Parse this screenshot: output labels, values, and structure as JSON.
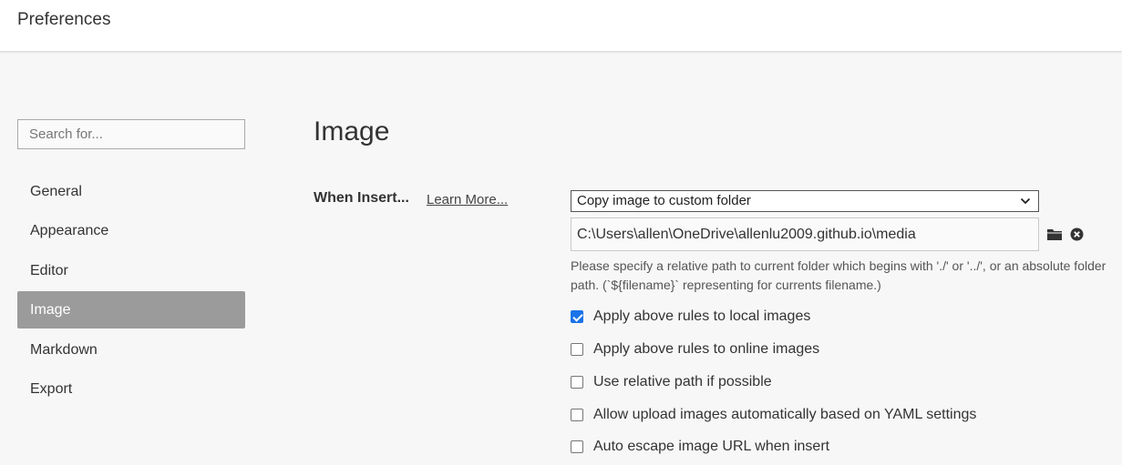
{
  "window": {
    "title": "Preferences"
  },
  "search": {
    "placeholder": "Search for..."
  },
  "sidebar": {
    "items": [
      {
        "label": "General",
        "active": false
      },
      {
        "label": "Appearance",
        "active": false
      },
      {
        "label": "Editor",
        "active": false
      },
      {
        "label": "Image",
        "active": true
      },
      {
        "label": "Markdown",
        "active": false
      },
      {
        "label": "Export",
        "active": false
      }
    ]
  },
  "main": {
    "title": "Image",
    "when_insert": {
      "label": "When Insert...",
      "learn_more": "Learn More...",
      "selected_option": "Copy image to custom folder",
      "path_value": "C:\\Users\\allen\\OneDrive\\allenlu2009.github.io\\media",
      "hint": " Please specify a relative path to current folder which begins with './' or '../', or an absolute folder path. (`${filename}` representing for currents filename.)"
    },
    "options": [
      {
        "label": "Apply above rules to local images",
        "checked": true
      },
      {
        "label": "Apply above rules to online images",
        "checked": false
      },
      {
        "label": "Use relative path if possible",
        "checked": false
      },
      {
        "label": "Allow upload images automatically based on YAML settings",
        "checked": false
      },
      {
        "label": "Auto escape image URL when insert",
        "checked": false
      }
    ]
  },
  "colors": {
    "accent": "#1a73e8",
    "active_nav": "#9b9b9b",
    "background": "#f7f7f7"
  },
  "icons": {
    "folder": "folder-icon",
    "clear": "clear-circle-icon",
    "dropdown": "chevron-down-icon"
  }
}
